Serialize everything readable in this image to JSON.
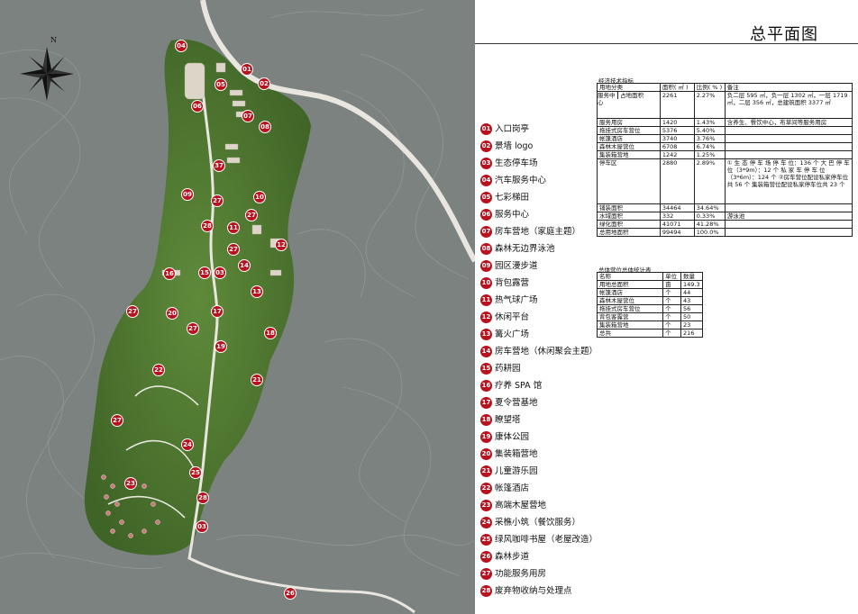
{
  "title": "总平面图",
  "compass": {
    "north": "N"
  },
  "colors": {
    "pin": "#b8121f",
    "terrain": "#7b827f",
    "road": "#e9e6df"
  },
  "pins": [
    {
      "n": "04"
    },
    {
      "n": "01"
    },
    {
      "n": "05"
    },
    {
      "n": "02"
    },
    {
      "n": "06"
    },
    {
      "n": "07"
    },
    {
      "n": "08"
    },
    {
      "n": "37"
    },
    {
      "n": "09"
    },
    {
      "n": "27"
    },
    {
      "n": "10"
    },
    {
      "n": "27"
    },
    {
      "n": "28"
    },
    {
      "n": "11"
    },
    {
      "n": "12"
    },
    {
      "n": "27"
    },
    {
      "n": "14"
    },
    {
      "n": "16"
    },
    {
      "n": "15"
    },
    {
      "n": "03"
    },
    {
      "n": "13"
    },
    {
      "n": "27"
    },
    {
      "n": "20"
    },
    {
      "n": "17"
    },
    {
      "n": "27"
    },
    {
      "n": "18"
    },
    {
      "n": "19"
    },
    {
      "n": "22"
    },
    {
      "n": "21"
    },
    {
      "n": "27"
    },
    {
      "n": "24"
    },
    {
      "n": "25"
    },
    {
      "n": "23"
    },
    {
      "n": "28"
    },
    {
      "n": "03"
    },
    {
      "n": "26"
    }
  ],
  "legend": [
    {
      "n": "01",
      "label": "入口岗亭"
    },
    {
      "n": "02",
      "label": "景墙 logo"
    },
    {
      "n": "03",
      "label": "生态停车场"
    },
    {
      "n": "04",
      "label": "汽车服务中心"
    },
    {
      "n": "05",
      "label": "七彩梯田"
    },
    {
      "n": "06",
      "label": "服务中心"
    },
    {
      "n": "07",
      "label": "房车营地（家庭主题）"
    },
    {
      "n": "08",
      "label": "森林无边界泳池"
    },
    {
      "n": "09",
      "label": "园区漫步道"
    },
    {
      "n": "10",
      "label": "背包露营"
    },
    {
      "n": "11",
      "label": "热气球广场"
    },
    {
      "n": "12",
      "label": "休闲平台"
    },
    {
      "n": "13",
      "label": "篝火广场"
    },
    {
      "n": "14",
      "label": "房车营地（休闲聚会主题）"
    },
    {
      "n": "15",
      "label": "药耕园"
    },
    {
      "n": "16",
      "label": "疗养 SPA 馆"
    },
    {
      "n": "17",
      "label": "夏令营基地"
    },
    {
      "n": "18",
      "label": "瞭望塔"
    },
    {
      "n": "19",
      "label": "康体公园"
    },
    {
      "n": "20",
      "label": "集装箱营地"
    },
    {
      "n": "21",
      "label": "儿童游乐园"
    },
    {
      "n": "22",
      "label": "帐篷酒店"
    },
    {
      "n": "23",
      "label": "高端木屋营地"
    },
    {
      "n": "24",
      "label": "采樵小筑（餐饮服务）"
    },
    {
      "n": "25",
      "label": "绿风咖啡书屋（老屋改造）"
    },
    {
      "n": "26",
      "label": "森林步道"
    },
    {
      "n": "27",
      "label": "功能服务用房"
    },
    {
      "n": "28",
      "label": "废弃物收纳与处理点"
    }
  ],
  "table1": {
    "title": "经济技术指标",
    "headers": [
      "用地分类",
      "面积( ㎡ )",
      "比例( % )",
      "备注"
    ],
    "service_center": "服务中心",
    "land_area": "占地面积",
    "land_value": "2261",
    "land_ratio": "2.27%",
    "land_note": "负二层 595 ㎡，负一层 1302 ㎡，一层 1719 ㎡，二层 356 ㎡，总建筑面积 3377 ㎡",
    "rows": [
      {
        "c": "服务用房",
        "a": "1420",
        "r": "1.43%",
        "n": "含养生、餐饮中心，布草间等服务用房"
      },
      {
        "c": "拖挂式房车营位",
        "a": "5376",
        "r": "5.40%",
        "n": ""
      },
      {
        "c": "帐篷酒店",
        "a": "3740",
        "r": "3.76%",
        "n": ""
      },
      {
        "c": "森林木屋营位",
        "a": "6708",
        "r": "6.74%",
        "n": ""
      },
      {
        "c": "集装箱营地",
        "a": "1242",
        "r": "1.25%",
        "n": ""
      }
    ],
    "parking": {
      "c": "停车区",
      "a": "2880",
      "r": "2.89%",
      "n": "① 生 态 停 车 场 停 车 位：136 个 大 巴 停 车 位（3*9m）：12 个 私 家 车 停 车 位（3*6m）：124 个 ②房车营位配设私家停车位共 56 个 集装箱营位配设私家停车位共 23 个"
    },
    "rows2": [
      {
        "c": "铺装面积",
        "a": "34464",
        "r": "34.64%",
        "n": ""
      },
      {
        "c": "水域面积",
        "a": "332",
        "r": "0.33%",
        "n": "游泳池"
      },
      {
        "c": "绿化面积",
        "a": "41071",
        "r": "41.28%",
        "n": ""
      },
      {
        "c": "总用地面积",
        "a": "99494",
        "r": "100.0%",
        "n": ""
      }
    ]
  },
  "table2": {
    "title": "总体营位总体统计表",
    "headers": [
      "名称",
      "单位",
      "数量"
    ],
    "rows": [
      {
        "c": "用地总面积",
        "u": "亩",
        "q": "149.3"
      },
      {
        "c": "帐篷酒店",
        "u": "个",
        "q": "44"
      },
      {
        "c": "森林木屋营位",
        "u": "个",
        "q": "43"
      },
      {
        "c": "拖挂式房车营位",
        "u": "个",
        "q": "56"
      },
      {
        "c": "背包客露营",
        "u": "个",
        "q": "50"
      },
      {
        "c": "集装箱营地",
        "u": "个",
        "q": "23"
      },
      {
        "c": "总共",
        "u": "个",
        "q": "216"
      }
    ]
  }
}
